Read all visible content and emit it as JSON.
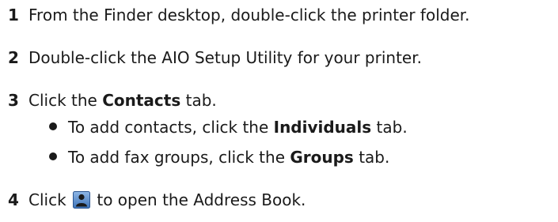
{
  "steps": [
    {
      "num": "1",
      "text": "From the Finder desktop, double-click the printer folder."
    },
    {
      "num": "2",
      "text": "Double-click the AIO Setup Utility for your printer."
    },
    {
      "num": "3",
      "before": "Click the ",
      "bold": "Contacts",
      "after": " tab."
    },
    {
      "num": "4",
      "before": "Click ",
      "after": " to open the Address Book."
    }
  ],
  "bullets": [
    {
      "before": "To add contacts, click the ",
      "bold": "Individuals",
      "after": " tab."
    },
    {
      "before": "To add fax groups, click the ",
      "bold": "Groups",
      "after": " tab."
    }
  ],
  "icons": {
    "address_book": "address-book-icon"
  }
}
